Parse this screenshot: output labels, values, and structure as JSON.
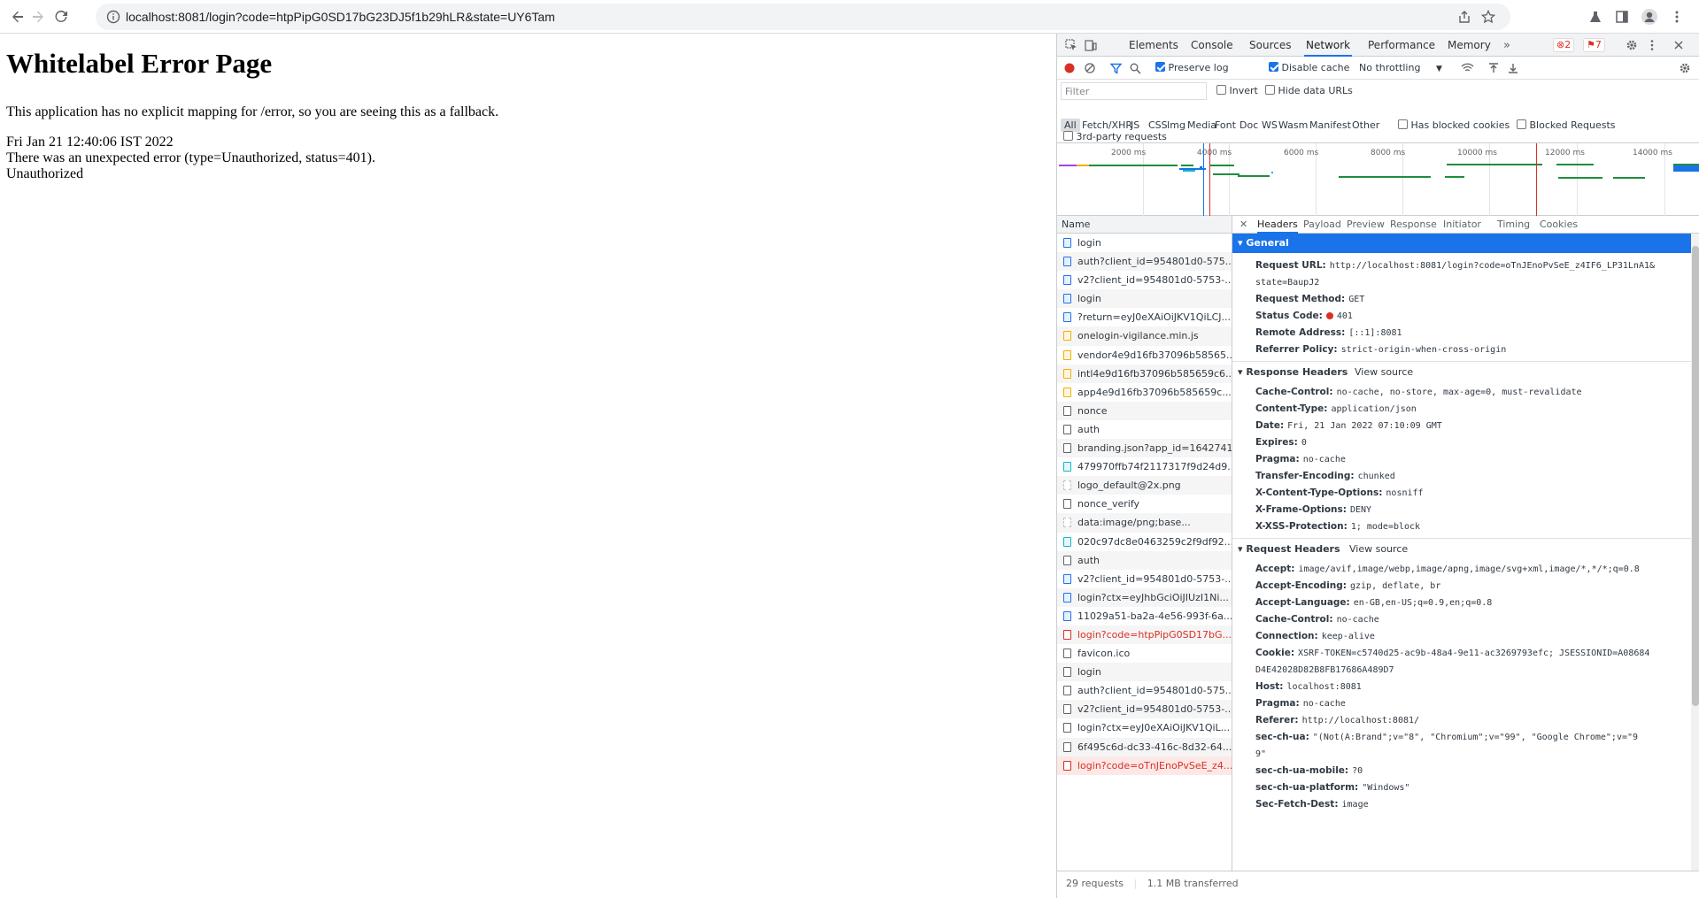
{
  "browser": {
    "url": "localhost:8081/login?code=htpPipG0SD17bG23DJ5f1b29hLR&state=UY6Tam"
  },
  "page": {
    "title": "Whitelabel Error Page",
    "message": "This application has no explicit mapping for /error, so you are seeing this as a fallback.",
    "timestamp": "Fri Jan 21 12:40:06 IST 2022",
    "error_line": "There was an unexpected error (type=Unauthorized, status=401).",
    "status_text": "Unauthorized"
  },
  "devtools": {
    "tabs": [
      "Elements",
      "Console",
      "Sources",
      "Network",
      "Performance",
      "Memory"
    ],
    "active_tab": "Network",
    "error_count": "2",
    "warning_count": "7",
    "preserve_log": "Preserve log",
    "disable_cache": "Disable cache",
    "throttling": "No throttling",
    "filter_placeholder": "Filter",
    "invert": "Invert",
    "hide_data_urls": "Hide data URLs",
    "type_filters": [
      "All",
      "Fetch/XHR",
      "JS",
      "CSS",
      "Img",
      "Media",
      "Font",
      "Doc",
      "WS",
      "Wasm",
      "Manifest",
      "Other"
    ],
    "has_blocked_cookies": "Has blocked cookies",
    "blocked_requests": "Blocked Requests",
    "third_party": "3rd-party requests",
    "overview_ticks": [
      "2000 ms",
      "4000 ms",
      "6000 ms",
      "8000 ms",
      "10000 ms",
      "12000 ms",
      "14000 ms"
    ],
    "name_header": "Name",
    "requests": [
      {
        "name": "login",
        "type": "doc"
      },
      {
        "name": "auth?client_id=954801d0-575...",
        "type": "doc"
      },
      {
        "name": "v2?client_id=954801d0-5753-...",
        "type": "doc"
      },
      {
        "name": "login",
        "type": "doc"
      },
      {
        "name": "?return=eyJ0eXAiOiJKV1QiLCJ...",
        "type": "doc"
      },
      {
        "name": "onelogin-vigilance.min.js",
        "type": "script"
      },
      {
        "name": "vendor4e9d16fb37096b58565...",
        "type": "script"
      },
      {
        "name": "intl4e9d16fb37096b585659c6...",
        "type": "script"
      },
      {
        "name": "app4e9d16fb37096b585659c...",
        "type": "script"
      },
      {
        "name": "nonce",
        "type": "other"
      },
      {
        "name": "auth",
        "type": "other"
      },
      {
        "name": "branding.json?app_id=1642741",
        "type": "other"
      },
      {
        "name": "479970ffb74f2117317f9d24d9...",
        "type": "font"
      },
      {
        "name": "logo_default@2x.png",
        "type": "img"
      },
      {
        "name": "nonce_verify",
        "type": "other"
      },
      {
        "name": "data:image/png;base...",
        "type": "img"
      },
      {
        "name": "020c97dc8e0463259c2f9df92...",
        "type": "font"
      },
      {
        "name": "auth",
        "type": "other"
      },
      {
        "name": "v2?client_id=954801d0-5753-...",
        "type": "doc"
      },
      {
        "name": "login?ctx=eyJhbGciOiJIUzI1Ni...",
        "type": "doc"
      },
      {
        "name": "11029a51-ba2a-4e56-993f-6a...",
        "type": "doc"
      },
      {
        "name": "login?code=htpPipG0SD17bG...",
        "type": "err"
      },
      {
        "name": "favicon.ico",
        "type": "other"
      },
      {
        "name": "login",
        "type": "other"
      },
      {
        "name": "auth?client_id=954801d0-575...",
        "type": "other"
      },
      {
        "name": "v2?client_id=954801d0-5753-...",
        "type": "other"
      },
      {
        "name": "login?ctx=eyJ0eXAiOiJKV1QiL...",
        "type": "other"
      },
      {
        "name": "6f495c6d-dc33-416c-8d32-64...",
        "type": "other"
      },
      {
        "name": "login?code=oTnJEnoPvSeE_z4...",
        "type": "err-selected"
      }
    ],
    "status_bar": {
      "requests": "29 requests",
      "transferred": "1.1 MB transferred"
    },
    "detail_tabs": [
      "Headers",
      "Payload",
      "Preview",
      "Response",
      "Initiator",
      "Timing",
      "Cookies"
    ],
    "general_label": "General",
    "general": [
      {
        "k": "Request URL:",
        "v": "http://localhost:8081/login?code=oTnJEnoPvSeE_z4IF6_LP31LnA1&"
      },
      {
        "k": "",
        "v": "state=BaupJ2"
      },
      {
        "k": "Request Method:",
        "v": "GET"
      },
      {
        "k": "Status Code:",
        "v": "401"
      },
      {
        "k": "Remote Address:",
        "v": "[::1]:8081"
      },
      {
        "k": "Referrer Policy:",
        "v": "strict-origin-when-cross-origin"
      }
    ],
    "response_headers_label": "Response Headers",
    "view_source": "View source",
    "response_headers": [
      {
        "k": "Cache-Control:",
        "v": "no-cache, no-store, max-age=0, must-revalidate"
      },
      {
        "k": "Content-Type:",
        "v": "application/json"
      },
      {
        "k": "Date:",
        "v": "Fri, 21 Jan 2022 07:10:09 GMT"
      },
      {
        "k": "Expires:",
        "v": "0"
      },
      {
        "k": "Pragma:",
        "v": "no-cache"
      },
      {
        "k": "Transfer-Encoding:",
        "v": "chunked"
      },
      {
        "k": "X-Content-Type-Options:",
        "v": "nosniff"
      },
      {
        "k": "X-Frame-Options:",
        "v": "DENY"
      },
      {
        "k": "X-XSS-Protection:",
        "v": "1; mode=block"
      }
    ],
    "request_headers_label": "Request Headers",
    "request_headers": [
      {
        "k": "Accept:",
        "v": "image/avif,image/webp,image/apng,image/svg+xml,image/*,*/*;q=0.8"
      },
      {
        "k": "Accept-Encoding:",
        "v": "gzip, deflate, br"
      },
      {
        "k": "Accept-Language:",
        "v": "en-GB,en-US;q=0.9,en;q=0.8"
      },
      {
        "k": "Cache-Control:",
        "v": "no-cache"
      },
      {
        "k": "Connection:",
        "v": "keep-alive"
      },
      {
        "k": "Cookie:",
        "v": "XSRF-TOKEN=c5740d25-ac9b-48a4-9e11-ac3269793efc; JSESSIONID=A08684"
      },
      {
        "k": "",
        "v": "D4E42028D82B8FB17686A489D7"
      },
      {
        "k": "Host:",
        "v": "localhost:8081"
      },
      {
        "k": "Pragma:",
        "v": "no-cache"
      },
      {
        "k": "Referer:",
        "v": "http://localhost:8081/"
      },
      {
        "k": "sec-ch-ua:",
        "v": "\"(Not(A:Brand\";v=\"8\", \"Chromium\";v=\"99\", \"Google Chrome\";v=\"9"
      },
      {
        "k": "",
        "v": "9\""
      },
      {
        "k": "sec-ch-ua-mobile:",
        "v": "?0"
      },
      {
        "k": "sec-ch-ua-platform:",
        "v": "\"Windows\""
      },
      {
        "k": "Sec-Fetch-Dest:",
        "v": "image"
      }
    ]
  }
}
